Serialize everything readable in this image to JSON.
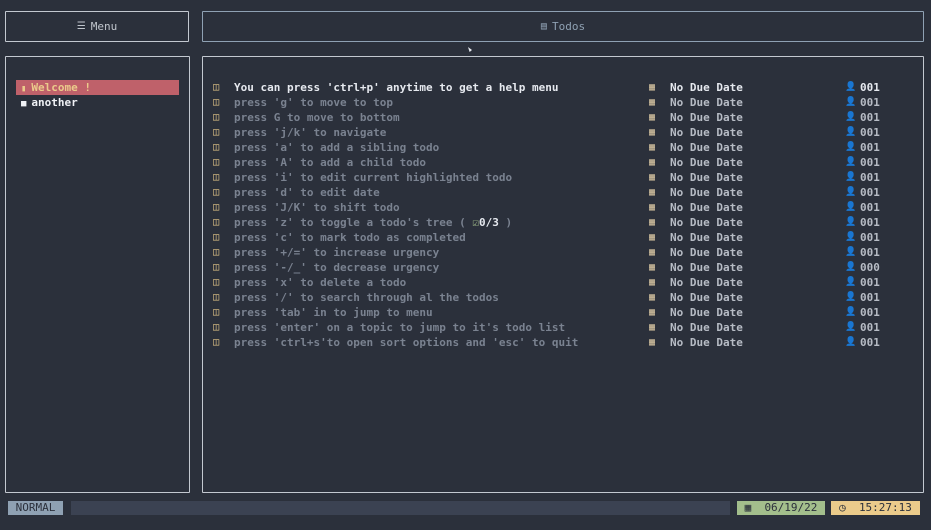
{
  "header": {
    "menu_icon": "hamburger-icon",
    "menu_label": "Menu",
    "todos_icon": "document-icon",
    "todos_label": "Todos"
  },
  "sidebar": {
    "items": [
      {
        "icon": "file-icon",
        "label": "Welcome !",
        "active": true
      },
      {
        "icon": "folder-icon",
        "label": "another",
        "active": false
      }
    ]
  },
  "todos": [
    {
      "text": "You can press 'ctrl+p' anytime to get a help menu",
      "due": "No Due Date",
      "urgency": "001"
    },
    {
      "text": "press 'g' to move to top",
      "due": "No Due Date",
      "urgency": "001"
    },
    {
      "text": "press G to move to bottom",
      "due": "No Due Date",
      "urgency": "001"
    },
    {
      "text": "press 'j/k' to navigate",
      "due": "No Due Date",
      "urgency": "001"
    },
    {
      "text": "press 'a' to add a sibling todo",
      "due": "No Due Date",
      "urgency": "001"
    },
    {
      "text": "press 'A' to add a child todo",
      "due": "No Due Date",
      "urgency": "001"
    },
    {
      "text": "press 'i' to edit current highlighted todo",
      "due": "No Due Date",
      "urgency": "001"
    },
    {
      "text": "press 'd' to edit date",
      "due": "No Due Date",
      "urgency": "001"
    },
    {
      "text": "press 'J/K' to shift todo",
      "due": "No Due Date",
      "urgency": "001"
    },
    {
      "text": "press 'z' to toggle a todo's tree (",
      "subtask_count": "0/3",
      "suffix": ")",
      "due": "No Due Date",
      "urgency": "001"
    },
    {
      "text": "press 'c' to mark todo as completed",
      "due": "No Due Date",
      "urgency": "001"
    },
    {
      "text": "press '+/=' to increase urgency",
      "due": "No Due Date",
      "urgency": "001"
    },
    {
      "text": "press '-/_' to decrease urgency",
      "due": "No Due Date",
      "urgency": "000"
    },
    {
      "text": "press 'x' to delete a todo",
      "due": "No Due Date",
      "urgency": "001"
    },
    {
      "text": "press '/' to search through al the todos",
      "due": "No Due Date",
      "urgency": "001"
    },
    {
      "text": "press 'tab' in to jump to menu",
      "due": "No Due Date",
      "urgency": "001"
    },
    {
      "text": "press 'enter' on a topic to jump to it's todo list",
      "due": "No Due Date",
      "urgency": "001"
    },
    {
      "text": "press 'ctrl+s'to open sort options and 'esc' to quit",
      "due": "No Due Date",
      "urgency": "001"
    }
  ],
  "status": {
    "mode": "NORMAL",
    "date": "06/19/22",
    "time": "15:27:13"
  },
  "colors": {
    "background": "#2b303b",
    "accent": "#8fa1b3",
    "active_topic": "#bf616a",
    "date_badge": "#a3be8c",
    "time_badge": "#ebcb8b"
  }
}
